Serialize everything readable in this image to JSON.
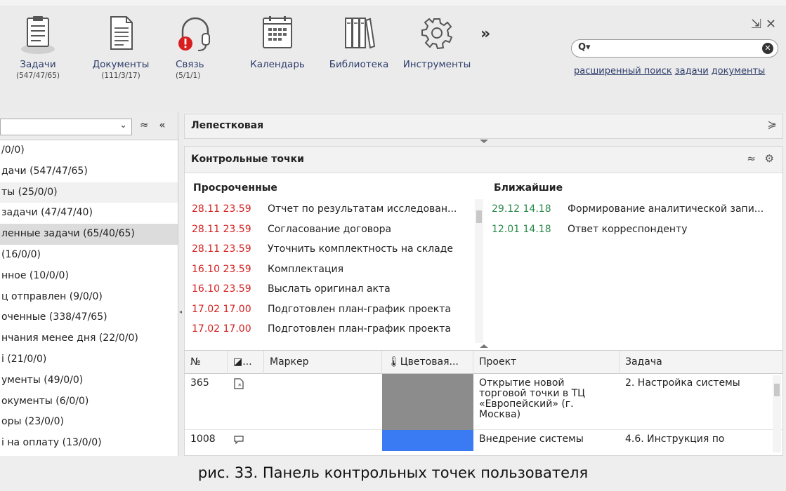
{
  "toolbar": {
    "tasks": {
      "label": "Задачи",
      "count": "(547/47/65)"
    },
    "documents": {
      "label": "Документы",
      "count": "(111/3/17)"
    },
    "comm": {
      "label": "Связь",
      "count": "(5/1/1)"
    },
    "calendar": {
      "label": "Календарь"
    },
    "library": {
      "label": "Библиотека"
    },
    "tools": {
      "label": "Инструменты"
    },
    "more": "»",
    "window_controls": "⇲ ✕"
  },
  "search": {
    "placeholder": "",
    "icon": "Q▾",
    "clear": "✕",
    "links": [
      "расширенный поиск",
      "задачи",
      "документы"
    ]
  },
  "left_panel": {
    "select_value": "",
    "controls": "≈ «",
    "items": [
      "/0/0)",
      "дачи (547/47/65)",
      "ты (25/0/0)",
      " задачи (47/47/40)",
      "ленные задачи (65/40/65)",
      " (16/0/0)",
      "нное (10/0/0)",
      "ц отправлен (9/0/0)",
      "оченные (338/47/65)",
      "нчания менее дня (22/0/0)",
      "і (21/0/0)",
      "ументы (49/0/0)",
      "окументы (6/0/0)",
      "оры (23/0/0)",
      "і на оплату (13/0/0)"
    ]
  },
  "petal_panel": {
    "title": "Лепестковая",
    "collapse": "≽"
  },
  "checkpoints": {
    "title": "Контрольные точки",
    "controls": "≈ ⚙",
    "overdue": {
      "title": "Просроченные",
      "rows": [
        {
          "date": "28.11 23.59",
          "text": "Отчет по результатам исследован..."
        },
        {
          "date": "28.11 23.59",
          "text": "Согласование договора"
        },
        {
          "date": "28.11 23.59",
          "text": "Уточнить комплектность на складе"
        },
        {
          "date": "16.10 23.59",
          "text": "Комплектация"
        },
        {
          "date": "16.10 23.59",
          "text": "Выслать оригинал акта"
        },
        {
          "date": "17.02 17.00",
          "text": "Подготовлен план-график проекта"
        },
        {
          "date": "17.02 17.00",
          "text": "Подготовлен план-график проекта"
        }
      ]
    },
    "upcoming": {
      "title": "Ближайшие",
      "rows": [
        {
          "date": "29.12 14.18",
          "text": "Формирование аналитической запи..."
        },
        {
          "date": "12.01 14.18",
          "text": "Ответ корреспонденту"
        }
      ]
    }
  },
  "table": {
    "headers": [
      "№",
      "...",
      "Маркер",
      "Цветовая...",
      "Проект",
      "Задача"
    ],
    "rows": [
      {
        "num": "365",
        "marker": "",
        "color": "#8c8c8c",
        "project": "Открытие новой торговой точки в ТЦ «Европейский» (г. Москва)",
        "task": "2. Настройка системы"
      },
      {
        "num": "1008",
        "marker": "",
        "color": "#3a7af2",
        "project": "Внедрение системы",
        "task": "4.6. Инструкция по"
      }
    ]
  },
  "caption": "рис. 33. Панель контрольных точек пользователя"
}
